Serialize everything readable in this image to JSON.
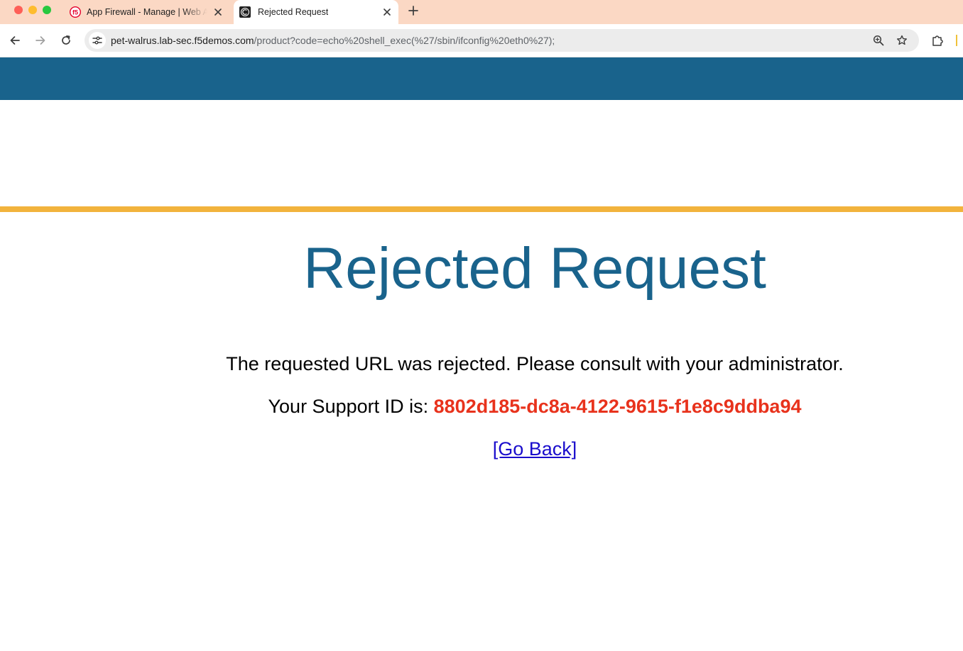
{
  "browser": {
    "tabs": [
      {
        "title": "App Firewall - Manage | Web App",
        "favicon": "f5-logo-icon",
        "active": false
      },
      {
        "title": "Rejected Request",
        "favicon": "site-c-icon",
        "active": true
      }
    ],
    "new_tab_icon": "plus-icon",
    "nav": {
      "back_icon": "arrow-left-icon",
      "forward_icon": "arrow-right-icon",
      "reload_icon": "reload-icon"
    },
    "address_bar": {
      "host": "pet-walrus.lab-sec.f5demos.com",
      "path": "/product?code=echo%20shell_exec(%27/sbin/ifconfig%20eth0%27);",
      "site_info_icon": "tune-icon",
      "zoom_icon": "zoom-icon",
      "bookmark_icon": "star-icon"
    },
    "extensions_icon": "puzzle-icon"
  },
  "page": {
    "title": "Rejected Request",
    "message": "The requested URL was rejected. Please consult with your administrator.",
    "support_label": "Your Support ID is: ",
    "support_id": "8802d185-dc8a-4122-9615-f1e8c9ddba94",
    "go_back_label": "[Go Back]"
  },
  "colors": {
    "tabstrip_bg": "#fbd8c4",
    "header_band": "#19638c",
    "accent_rule": "#f2b33d",
    "title": "#19638c",
    "support_id": "#e8321c",
    "link": "#1a0dcc"
  }
}
